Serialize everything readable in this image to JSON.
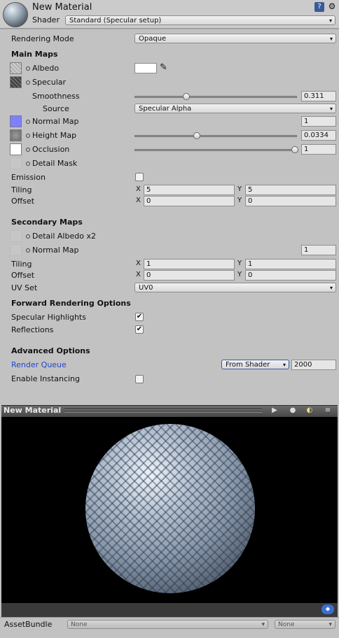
{
  "header": {
    "title": "New Material",
    "shader_label": "Shader",
    "shader_value": "Standard (Specular setup)",
    "help_icon": "book-icon",
    "settings_icon": "gear-icon"
  },
  "rendering_mode": {
    "label": "Rendering Mode",
    "value": "Opaque"
  },
  "main_maps": {
    "heading": "Main Maps",
    "albedo": {
      "label": "Albedo",
      "color": "#ffffff"
    },
    "specular": {
      "label": "Specular"
    },
    "smoothness": {
      "label": "Smoothness",
      "value": "0.311",
      "fraction": 0.311
    },
    "source": {
      "label": "Source",
      "value": "Specular Alpha"
    },
    "normal_map": {
      "label": "Normal Map",
      "value": "1",
      "swatch_color": "#8080ff"
    },
    "height_map": {
      "label": "Height Map",
      "value": "0.0334",
      "fraction": 0.38
    },
    "occlusion": {
      "label": "Occlusion",
      "value": "1",
      "fraction": 1.0
    },
    "detail_mask": {
      "label": "Detail Mask"
    },
    "emission": {
      "label": "Emission",
      "checked": false
    },
    "tiling": {
      "label": "Tiling",
      "x_label": "X",
      "x": "5",
      "y_label": "Y",
      "y": "5"
    },
    "offset": {
      "label": "Offset",
      "x_label": "X",
      "x": "0",
      "y_label": "Y",
      "y": "0"
    }
  },
  "secondary_maps": {
    "heading": "Secondary Maps",
    "detail_albedo": {
      "label": "Detail Albedo x2"
    },
    "normal_map": {
      "label": "Normal Map",
      "value": "1"
    },
    "tiling": {
      "label": "Tiling",
      "x_label": "X",
      "x": "1",
      "y_label": "Y",
      "y": "1"
    },
    "offset": {
      "label": "Offset",
      "x_label": "X",
      "x": "0",
      "y_label": "Y",
      "y": "0"
    },
    "uv_set": {
      "label": "UV Set",
      "value": "UV0"
    }
  },
  "forward": {
    "heading": "Forward Rendering Options",
    "specular_highlights": {
      "label": "Specular Highlights",
      "checked": true
    },
    "reflections": {
      "label": "Reflections",
      "checked": true
    }
  },
  "advanced": {
    "heading": "Advanced Options",
    "render_queue": {
      "label": "Render Queue",
      "mode": "From Shader",
      "value": "2000"
    },
    "instancing": {
      "label": "Enable Instancing",
      "checked": false
    }
  },
  "preview": {
    "title": "New Material"
  },
  "asset_bundle": {
    "label": "AssetBundle",
    "name": "None",
    "variant": "None"
  },
  "check_mark": "✔"
}
